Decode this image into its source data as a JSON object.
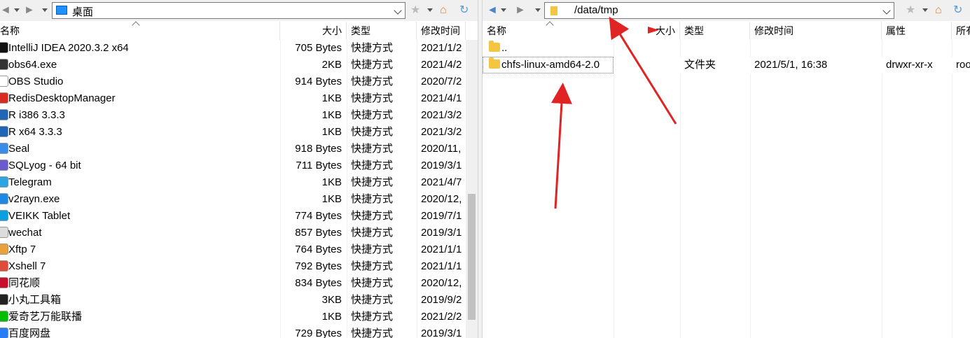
{
  "left": {
    "address": "桌面",
    "headers": {
      "name": "名称",
      "size": "大小",
      "type": "类型",
      "mtime": "修改时间"
    },
    "files": [
      {
        "name": "IntelliJ IDEA 2020.3.2 x64",
        "size": "705 Bytes",
        "type": "快捷方式",
        "mtime": "2021/1/2",
        "icon": "intellij-icon",
        "color": "#111111"
      },
      {
        "name": "obs64.exe",
        "size": "2KB",
        "type": "快捷方式",
        "mtime": "2021/4/2",
        "icon": "obs-icon",
        "color": "#333333"
      },
      {
        "name": "OBS Studio",
        "size": "914 Bytes",
        "type": "快捷方式",
        "mtime": "2020/7/2",
        "icon": "file-icon",
        "color": "#ffffff"
      },
      {
        "name": "RedisDesktopManager",
        "size": "1KB",
        "type": "快捷方式",
        "mtime": "2021/4/1",
        "icon": "redis-icon",
        "color": "#d82c20"
      },
      {
        "name": "R i386 3.3.3",
        "size": "1KB",
        "type": "快捷方式",
        "mtime": "2021/3/2",
        "icon": "r-icon",
        "color": "#2165b6"
      },
      {
        "name": "R x64 3.3.3",
        "size": "1KB",
        "type": "快捷方式",
        "mtime": "2021/3/2",
        "icon": "r-icon",
        "color": "#2165b6"
      },
      {
        "name": "Seal",
        "size": "918 Bytes",
        "type": "快捷方式",
        "mtime": "2020/11,",
        "icon": "seal-icon",
        "color": "#3b8be8"
      },
      {
        "name": "SQLyog - 64 bit",
        "size": "711 Bytes",
        "type": "快捷方式",
        "mtime": "2019/3/1",
        "icon": "sqlyog-icon",
        "color": "#6a5acd"
      },
      {
        "name": "Telegram",
        "size": "1KB",
        "type": "快捷方式",
        "mtime": "2021/4/7",
        "icon": "telegram-icon",
        "color": "#2ca5e0"
      },
      {
        "name": "v2rayn.exe",
        "size": "1KB",
        "type": "快捷方式",
        "mtime": "2020/12,",
        "icon": "v2ray-icon",
        "color": "#1e88e5"
      },
      {
        "name": "VEIKK Tablet",
        "size": "774 Bytes",
        "type": "快捷方式",
        "mtime": "2019/7/1",
        "icon": "veikk-icon",
        "color": "#0aa0e0"
      },
      {
        "name": "wechat",
        "size": "857 Bytes",
        "type": "快捷方式",
        "mtime": "2019/3/1",
        "icon": "wechat-icon",
        "color": "#dcdcdc"
      },
      {
        "name": "Xftp 7",
        "size": "764 Bytes",
        "type": "快捷方式",
        "mtime": "2021/1/1",
        "icon": "xftp-icon",
        "color": "#e9a23b"
      },
      {
        "name": "Xshell 7",
        "size": "792 Bytes",
        "type": "快捷方式",
        "mtime": "2021/1/1",
        "icon": "xshell-icon",
        "color": "#e04a3a"
      },
      {
        "name": "同花顺",
        "size": "834 Bytes",
        "type": "快捷方式",
        "mtime": "2020/12,",
        "icon": "ths-icon",
        "color": "#c8102e"
      },
      {
        "name": "小丸工具箱",
        "size": "3KB",
        "type": "快捷方式",
        "mtime": "2019/9/2",
        "icon": "xiaowan-icon",
        "color": "#222222"
      },
      {
        "name": "爱奇艺万能联播",
        "size": "1KB",
        "type": "快捷方式",
        "mtime": "2021/2/2",
        "icon": "iqiyi-icon",
        "color": "#00be06"
      },
      {
        "name": "百度网盘",
        "size": "729 Bytes",
        "type": "快捷方式",
        "mtime": "2019/3/1",
        "icon": "baidu-icon",
        "color": "#2a7bf6"
      }
    ]
  },
  "right": {
    "address": "/data/tmp",
    "headers": {
      "name": "名称",
      "size": "大小",
      "type": "类型",
      "mtime": "修改时间",
      "attr": "属性",
      "owner": "所有"
    },
    "files": [
      {
        "name": "..",
        "size": "",
        "type": "",
        "mtime": "",
        "attr": "",
        "owner": ""
      },
      {
        "name": "chfs-linux-amd64-2.0",
        "size": "",
        "type": "文件夹",
        "mtime": "2021/5/1, 16:38",
        "attr": "drwxr-xr-x",
        "owner": "roo"
      }
    ]
  },
  "colors": {
    "toolbar": "#f0f0f0",
    "nav_arrow": "#4a86c8",
    "folder": "#f4c542",
    "annotation": "#e02424"
  }
}
